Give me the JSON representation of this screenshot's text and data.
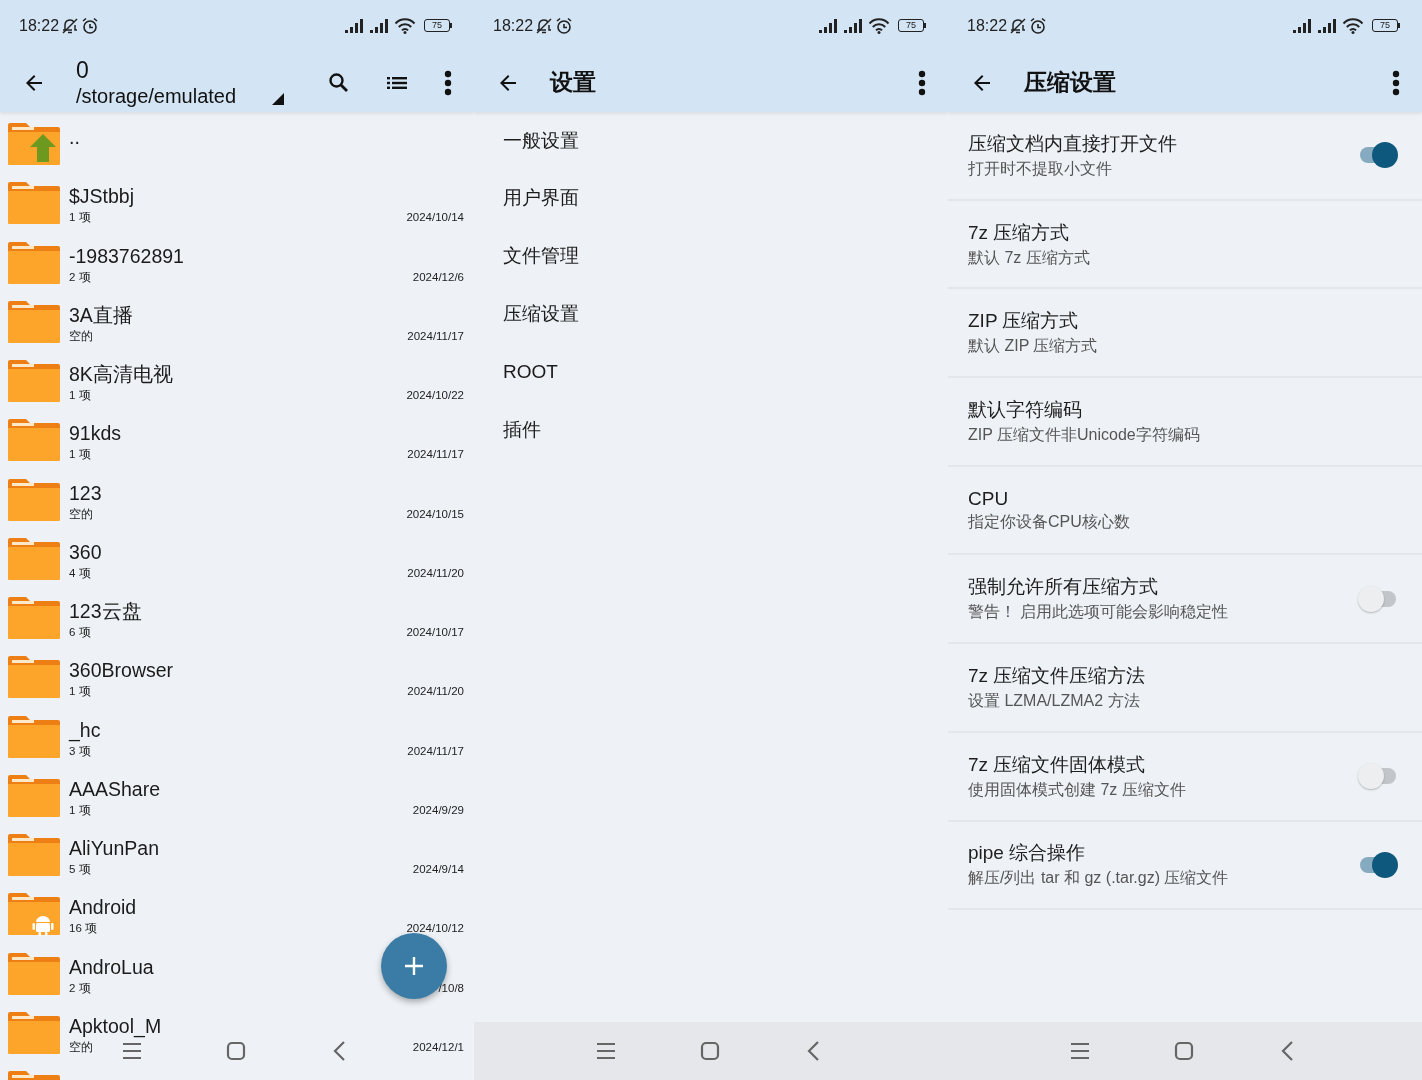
{
  "screens": [
    {
      "kind": "file_browser",
      "status_bar": {
        "time": "18:22",
        "battery": "75"
      },
      "toolbar": {
        "title": "0",
        "subtitle": "/storage/emulated"
      },
      "items": [
        {
          "kind": "up",
          "name": ".."
        },
        {
          "kind": "folder",
          "name": "$JStbbj",
          "count": "1 项",
          "date": "2024/10/14"
        },
        {
          "kind": "folder",
          "name": "-1983762891",
          "count": "2 项",
          "date": "2024/12/6"
        },
        {
          "kind": "folder",
          "name": "3A直播",
          "count": "空的",
          "date": "2024/11/17"
        },
        {
          "kind": "folder",
          "name": "8K高清电视",
          "count": "1 项",
          "date": "2024/10/22"
        },
        {
          "kind": "folder",
          "name": "91kds",
          "count": "1 项",
          "date": "2024/11/17"
        },
        {
          "kind": "folder",
          "name": "123",
          "count": "空的",
          "date": "2024/10/15"
        },
        {
          "kind": "folder",
          "name": "360",
          "count": "4 项",
          "date": "2024/11/20"
        },
        {
          "kind": "folder",
          "name": "123云盘",
          "count": "6 项",
          "date": "2024/10/17"
        },
        {
          "kind": "folder",
          "name": "360Browser",
          "count": "1 项",
          "date": "2024/11/20"
        },
        {
          "kind": "folder",
          "name": "_hc",
          "count": "3 项",
          "date": "2024/11/17"
        },
        {
          "kind": "folder",
          "name": "AAAShare",
          "count": "1 项",
          "date": "2024/9/29"
        },
        {
          "kind": "folder",
          "name": "AliYunPan",
          "count": "5 项",
          "date": "2024/9/14"
        },
        {
          "kind": "android",
          "name": "Android",
          "count": "16 项",
          "date": "2024/10/12"
        },
        {
          "kind": "folder",
          "name": "AndroLua",
          "count": "2 项",
          "date": "/10/8"
        },
        {
          "kind": "folder",
          "name": "Apktool_M",
          "count": "空的",
          "date": "2024/12/1"
        },
        {
          "kind": "folder"
        }
      ]
    },
    {
      "kind": "settings",
      "status_bar": {
        "time": "18:22",
        "battery": "75"
      },
      "toolbar": {
        "title": "设置"
      },
      "items": [
        {
          "label": "一般设置"
        },
        {
          "label": "用户界面"
        },
        {
          "label": "文件管理"
        },
        {
          "label": "压缩设置"
        },
        {
          "label": "ROOT"
        },
        {
          "label": "插件"
        }
      ]
    },
    {
      "kind": "compression_settings",
      "status_bar": {
        "time": "18:22",
        "battery": "75"
      },
      "toolbar": {
        "title": "压缩设置"
      },
      "items": [
        {
          "kind": "switch",
          "title": "压缩文档内直接打开文件",
          "subtitle": "打开时不提取小文件",
          "on": true
        },
        {
          "kind": "text",
          "title": "7z 压缩方式",
          "subtitle": "默认 7z 压缩方式"
        },
        {
          "kind": "text",
          "title": "ZIP 压缩方式",
          "subtitle": "默认 ZIP 压缩方式"
        },
        {
          "kind": "text",
          "title": "默认字符编码",
          "subtitle": "ZIP 压缩文件非Unicode字符编码"
        },
        {
          "kind": "text",
          "title": "CPU",
          "subtitle": "指定你设备CPU核心数"
        },
        {
          "kind": "switch",
          "title": "强制允许所有压缩方式",
          "subtitle": "警告！ 启用此选项可能会影响稳定性",
          "on": false
        },
        {
          "kind": "text",
          "title": "7z 压缩文件压缩方法",
          "subtitle": "设置 LZMA/LZMA2 方法"
        },
        {
          "kind": "switch",
          "title": "7z 压缩文件固体模式",
          "subtitle": "使用固体模式创建 7z 压缩文件",
          "on": false
        },
        {
          "kind": "switch",
          "title": "pipe 综合操作",
          "subtitle": "解压/列出 tar 和 gz (.tar.gz) 压缩文件",
          "on": true
        }
      ]
    }
  ]
}
